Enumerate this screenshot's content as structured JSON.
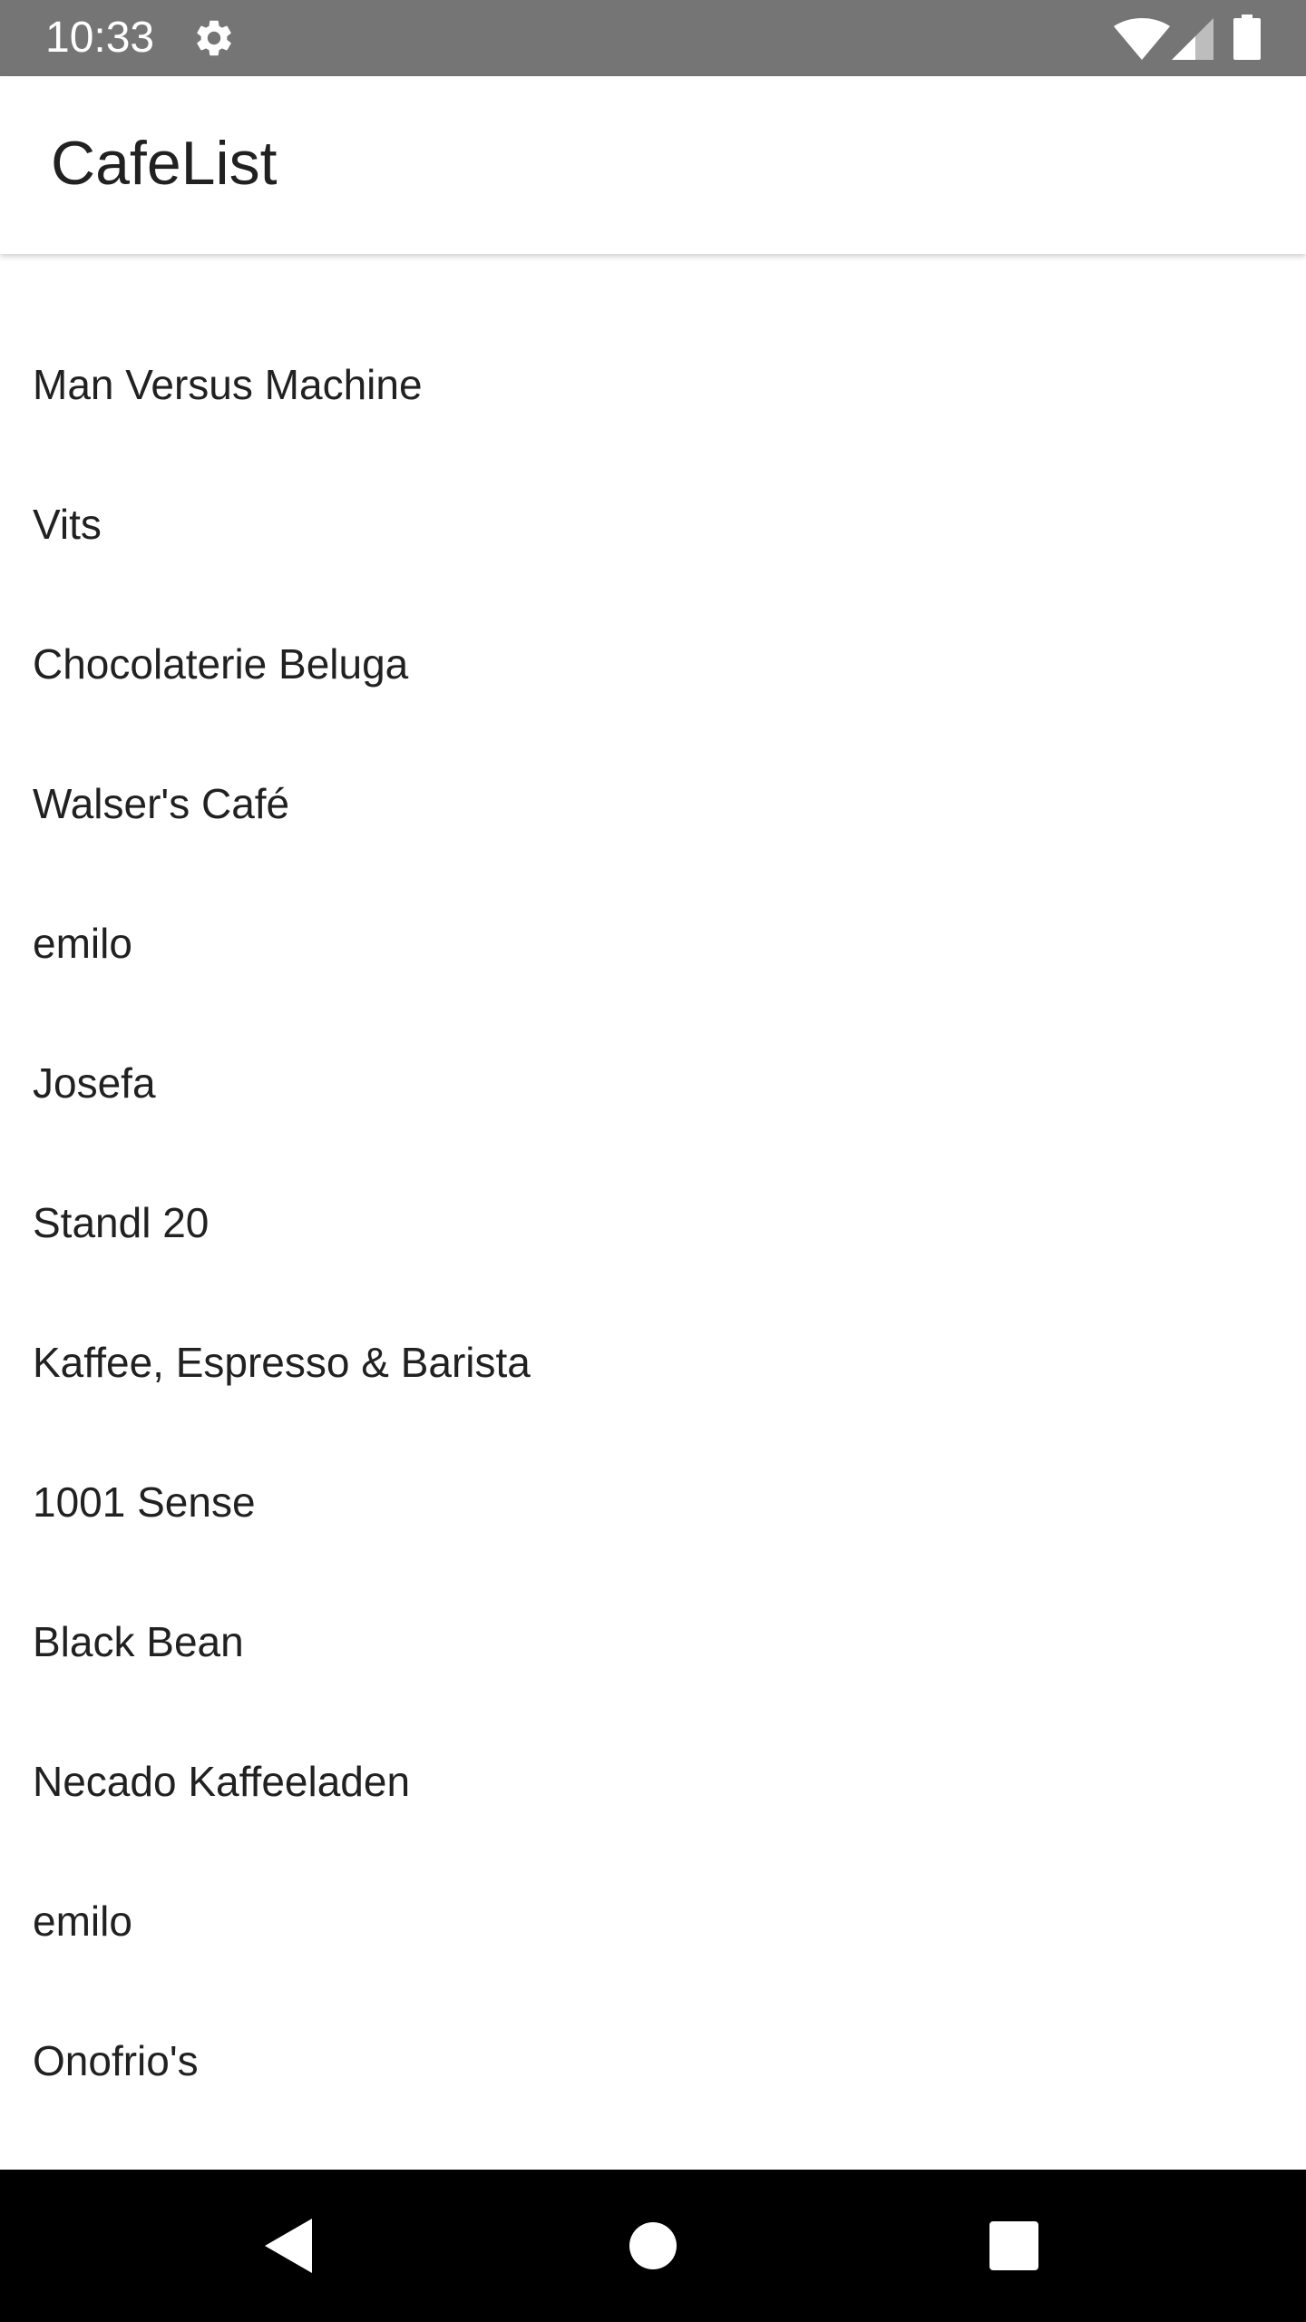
{
  "status_bar": {
    "time": "10:33",
    "icons": [
      "gear-icon",
      "wifi-icon",
      "cell-signal-icon",
      "battery-icon"
    ]
  },
  "app_bar": {
    "title": "CafeList"
  },
  "cafes": [
    "Man Versus Machine",
    "Vits",
    "Chocolaterie Beluga",
    "Walser's Café",
    "emilo",
    "Josefa",
    "Standl 20",
    "Kaffee, Espresso & Barista",
    "1001 Sense",
    "Black Bean",
    "Necado Kaffeeladen",
    "emilo",
    "Onofrio's"
  ],
  "nav_bar": {
    "buttons": [
      "back-icon",
      "home-icon",
      "recents-icon"
    ]
  },
  "colors": {
    "status_bar": "#757575",
    "app_bar": "#ffffff",
    "text": "#212121",
    "nav_bar": "#000000",
    "nav_icon": "#ffffff"
  }
}
